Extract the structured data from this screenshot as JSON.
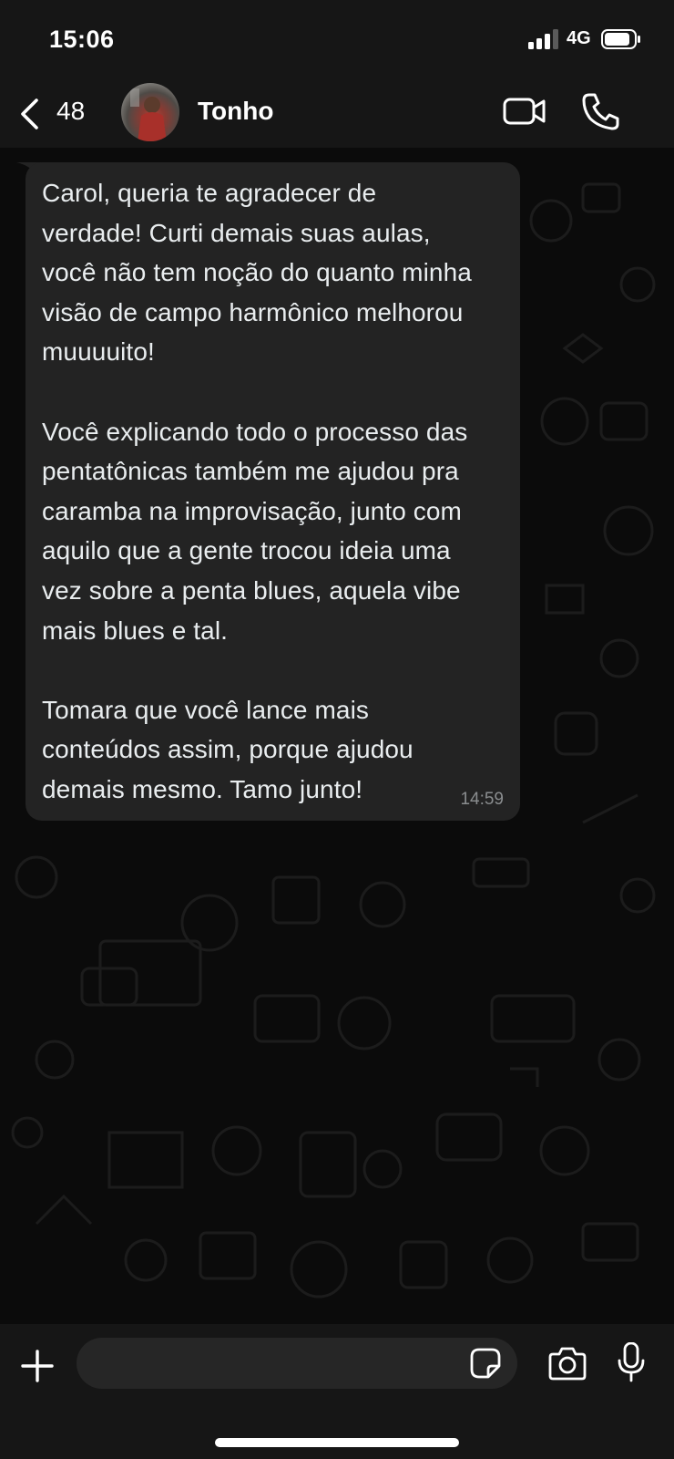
{
  "status_bar": {
    "time": "15:06",
    "network": "4G"
  },
  "header": {
    "unread_count": "48",
    "contact_name": "Tonho",
    "icons": [
      "chevron-left-icon",
      "video-camera-icon",
      "phone-icon"
    ]
  },
  "message": {
    "text": "Carol, queria te agradecer de\nverdade! Curti demais suas aulas,\nvocê não tem noção do quanto minha\nvisão de campo harmônico melhorou\nmuuuuito!\n\nVocê explicando todo o processo das\npentatônicas também me ajudou pra\ncaramba na improvisação, junto com\naquilo que a gente trocou ideia uma\nvez sobre a penta blues, aquela vibe\nmais blues e tal.\n\nTomara que você lance mais\nconteúdos assim, porque ajudou\ndemais mesmo. Tamo junto!",
    "time": "14:59"
  },
  "input_bar": {
    "placeholder": "",
    "icons": [
      "plus-icon",
      "sticker-icon",
      "camera-icon",
      "microphone-icon"
    ]
  },
  "colors": {
    "background": "#0b0b0b",
    "bars": "#161616",
    "bubble": "#232323",
    "text": "#e9edef",
    "timestamp": "#8a8d8f"
  }
}
